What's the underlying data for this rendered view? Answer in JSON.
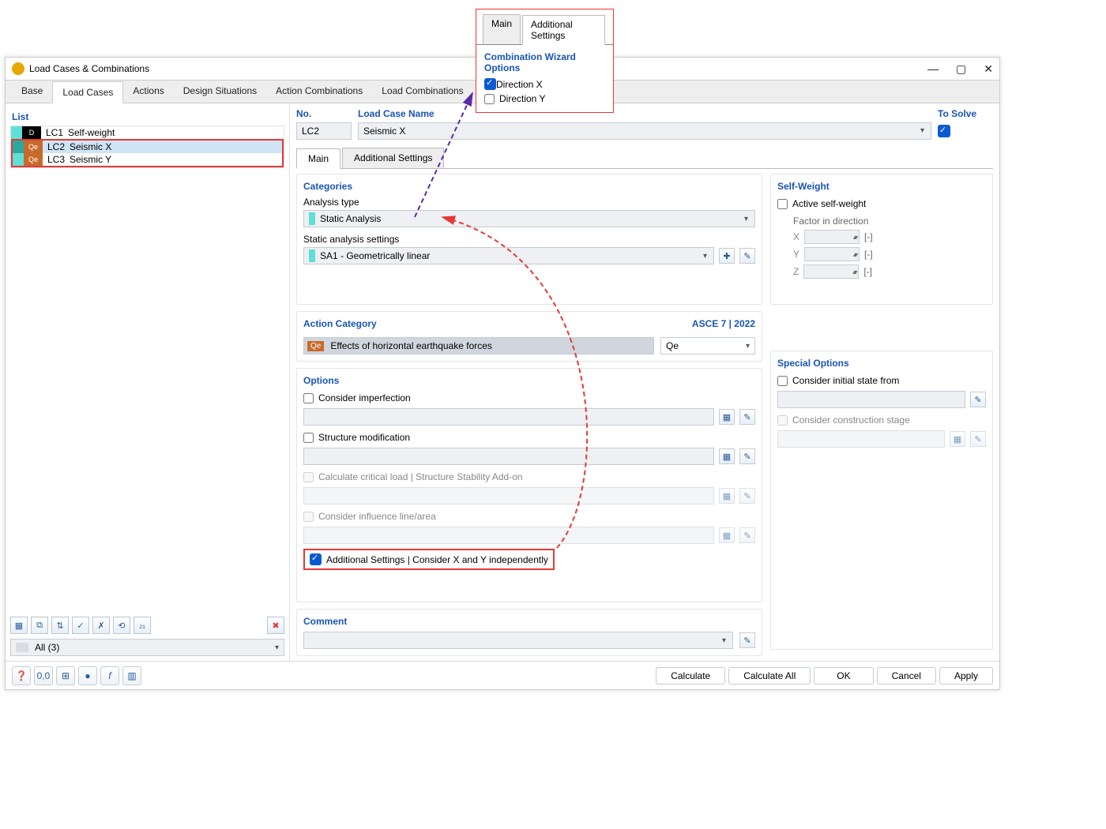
{
  "callout": {
    "tabs": {
      "main": "Main",
      "additional": "Additional Settings"
    },
    "title": "Combination Wizard Options",
    "dirx": "Direction X",
    "diry": "Direction Y"
  },
  "window": {
    "title": "Load Cases & Combinations",
    "tabs": {
      "base": "Base",
      "loadcases": "Load Cases",
      "actions": "Actions",
      "designsit": "Design Situations",
      "actioncomb": "Action Combinations",
      "loadcomb": "Load Combinations"
    }
  },
  "list": {
    "title": "List",
    "items": [
      {
        "tag": "D",
        "code": "LC1",
        "name": "Self-weight"
      },
      {
        "tag": "Qe",
        "code": "LC2",
        "name": "Seismic X"
      },
      {
        "tag": "Qe",
        "code": "LC3",
        "name": "Seismic Y"
      }
    ],
    "filter": "All (3)"
  },
  "header": {
    "no_label": "No.",
    "no_value": "LC2",
    "name_label": "Load Case Name",
    "name_value": "Seismic X",
    "solve_label": "To Solve"
  },
  "innerTabs": {
    "main": "Main",
    "additional": "Additional Settings"
  },
  "categories": {
    "title": "Categories",
    "analysis_label": "Analysis type",
    "analysis_value": "Static Analysis",
    "sas_label": "Static analysis settings",
    "sas_value": "SA1 - Geometrically linear"
  },
  "action": {
    "title": "Action Category",
    "standard": "ASCE 7 | 2022",
    "cat_value": "Effects of horizontal earthquake forces",
    "cat_tag": "Qe",
    "short": "Qe"
  },
  "options": {
    "title": "Options",
    "imperfection": "Consider imperfection",
    "structure_mod": "Structure modification",
    "critical": "Calculate critical load | Structure Stability Add-on",
    "influence": "Consider influence line/area",
    "additional": "Additional Settings | Consider X and Y independently"
  },
  "selfweight": {
    "title": "Self-Weight",
    "active": "Active self-weight",
    "factor_label": "Factor in direction",
    "axes": {
      "x": "X",
      "y": "Y",
      "z": "Z"
    },
    "unit": "[-]"
  },
  "special": {
    "title": "Special Options",
    "initial": "Consider initial state from",
    "construction": "Consider construction stage"
  },
  "comment": {
    "title": "Comment"
  },
  "footer": {
    "calculate": "Calculate",
    "calculate_all": "Calculate All",
    "ok": "OK",
    "cancel": "Cancel",
    "apply": "Apply"
  }
}
